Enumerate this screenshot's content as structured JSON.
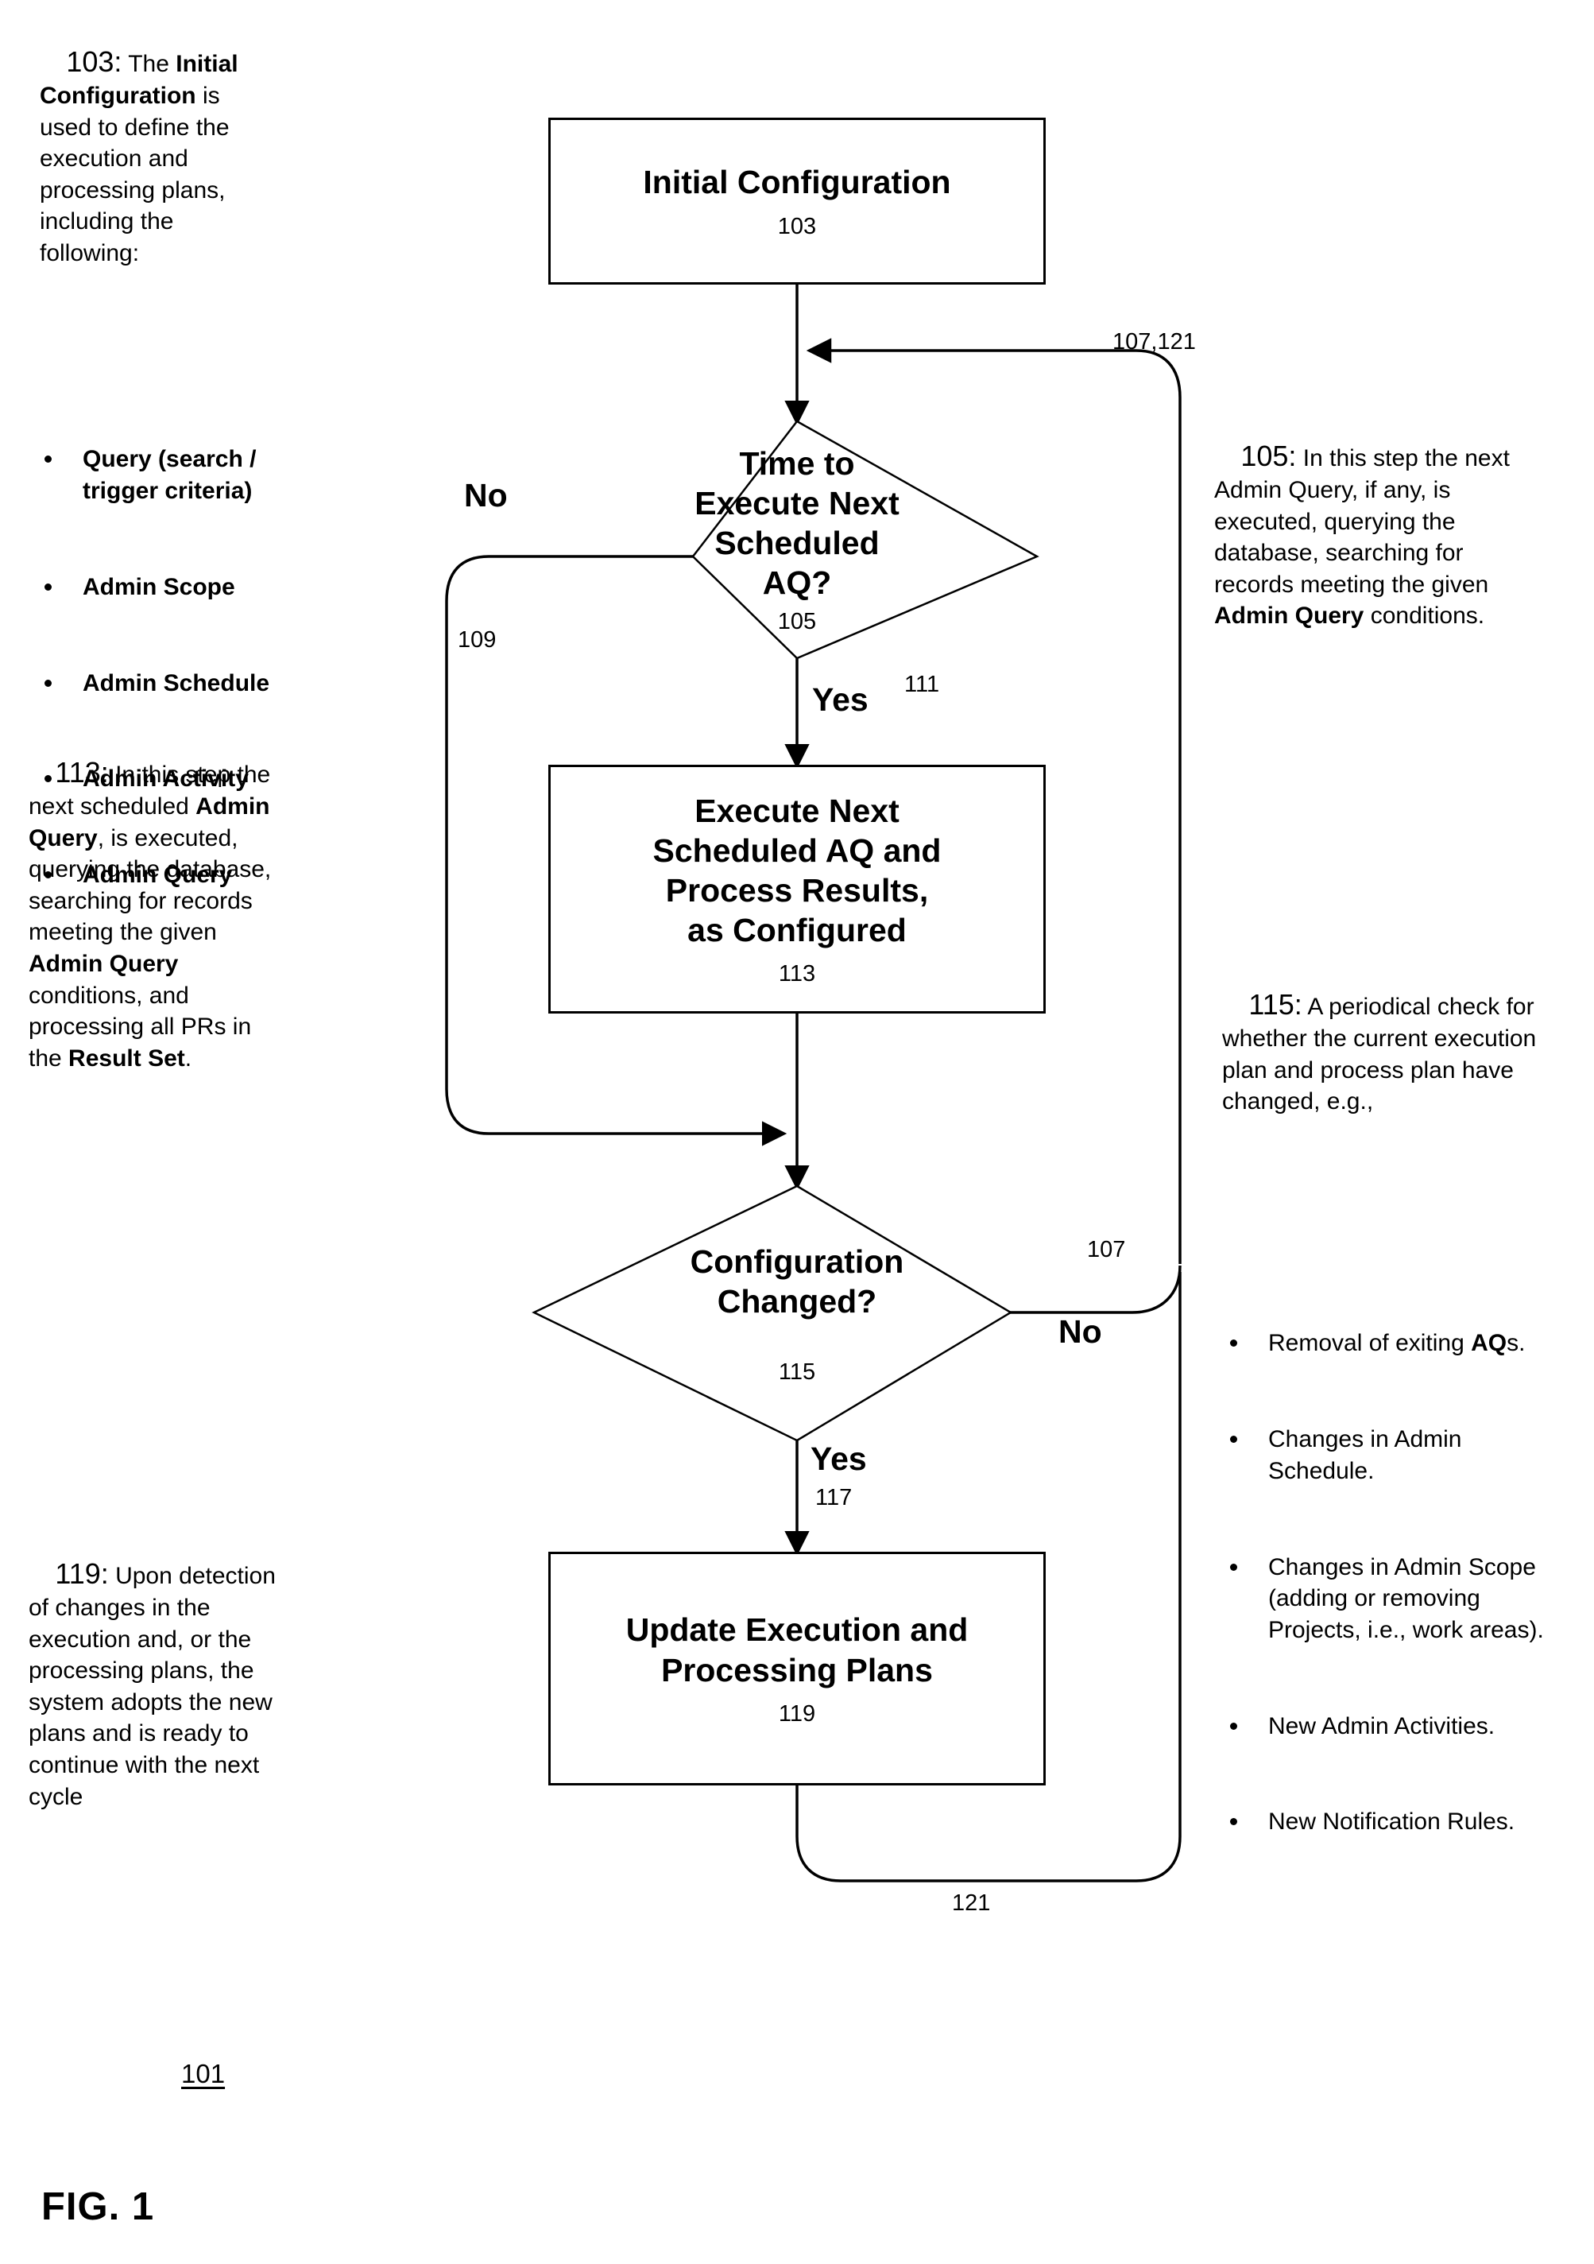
{
  "figure": {
    "caption": "FIG. 1",
    "system_ref": "101"
  },
  "nodes": {
    "initial_configuration": {
      "title": "Initial Configuration",
      "ref": "103"
    },
    "time_to_execute": {
      "title": "Time to\nExecute Next\nScheduled\nAQ?",
      "ref": "105"
    },
    "execute_next": {
      "title": "Execute Next\nScheduled AQ and\nProcess Results,\nas Configured",
      "ref": "113"
    },
    "configuration_changed": {
      "title": "Configuration\nChanged?",
      "ref": "115"
    },
    "update_plans": {
      "title": "Update Execution and\nProcessing Plans",
      "ref": "119"
    }
  },
  "edges": {
    "no_from_time_to_execute": {
      "label": "No",
      "ref": "109"
    },
    "yes_from_time_to_execute": {
      "label": "Yes",
      "ref": "111"
    },
    "no_from_config_changed": {
      "label": "No",
      "ref": "107"
    },
    "yes_from_config_changed": {
      "label": "Yes",
      "ref": "117"
    },
    "return_to_top": {
      "ref": "107,121"
    },
    "bottom_loop": {
      "ref": "121"
    }
  },
  "annotations": {
    "a103": {
      "ref": "103:",
      "body_before": " The ",
      "bold1": "Initial Configuration",
      "body_after": " is used to define the execution and processing plans, including the following:",
      "bullets": [
        "Query (search / trigger criteria)",
        "Admin Scope",
        "Admin Schedule",
        "Admin Activity",
        "Admin Query"
      ]
    },
    "a113": {
      "ref": "113:",
      "seg1": " In this step the next scheduled ",
      "bold1": "Admin Query",
      "seg2": ", is executed, querying the database, searching for records meeting the given ",
      "bold2": "Admin Query",
      "seg3": " conditions, and processing all PRs in the ",
      "bold3": "Result Set",
      "seg4": "."
    },
    "a119": {
      "ref": "119:",
      "body": " Upon detection of changes in the execution and, or the processing plans, the system adopts the new plans and is ready to continue with the next cycle"
    },
    "a105": {
      "ref": "105:",
      "seg1": " In this step the next Admin Query, if any, is executed, querying the database, searching for records meeting the given ",
      "bold1": "Admin Query",
      "seg2": " conditions."
    },
    "a115": {
      "ref": "115:",
      "seg1": " A periodical check for whether the current execution plan and process plan have changed, e.g.,",
      "bullets": [
        {
          "pre": "Removal of exiting ",
          "bold": "AQ",
          "post": "s."
        },
        {
          "pre": "Changes in Admin Schedule.",
          "bold": "",
          "post": ""
        },
        {
          "pre": "Changes in Admin Scope (adding or removing Projects, i.e., work areas).",
          "bold": "",
          "post": ""
        },
        {
          "pre": "New Admin Activities.",
          "bold": "",
          "post": ""
        },
        {
          "pre": "New Notification Rules.",
          "bold": "",
          "post": ""
        }
      ]
    }
  },
  "colors": {
    "ink": "#000000",
    "paper": "#ffffff"
  }
}
